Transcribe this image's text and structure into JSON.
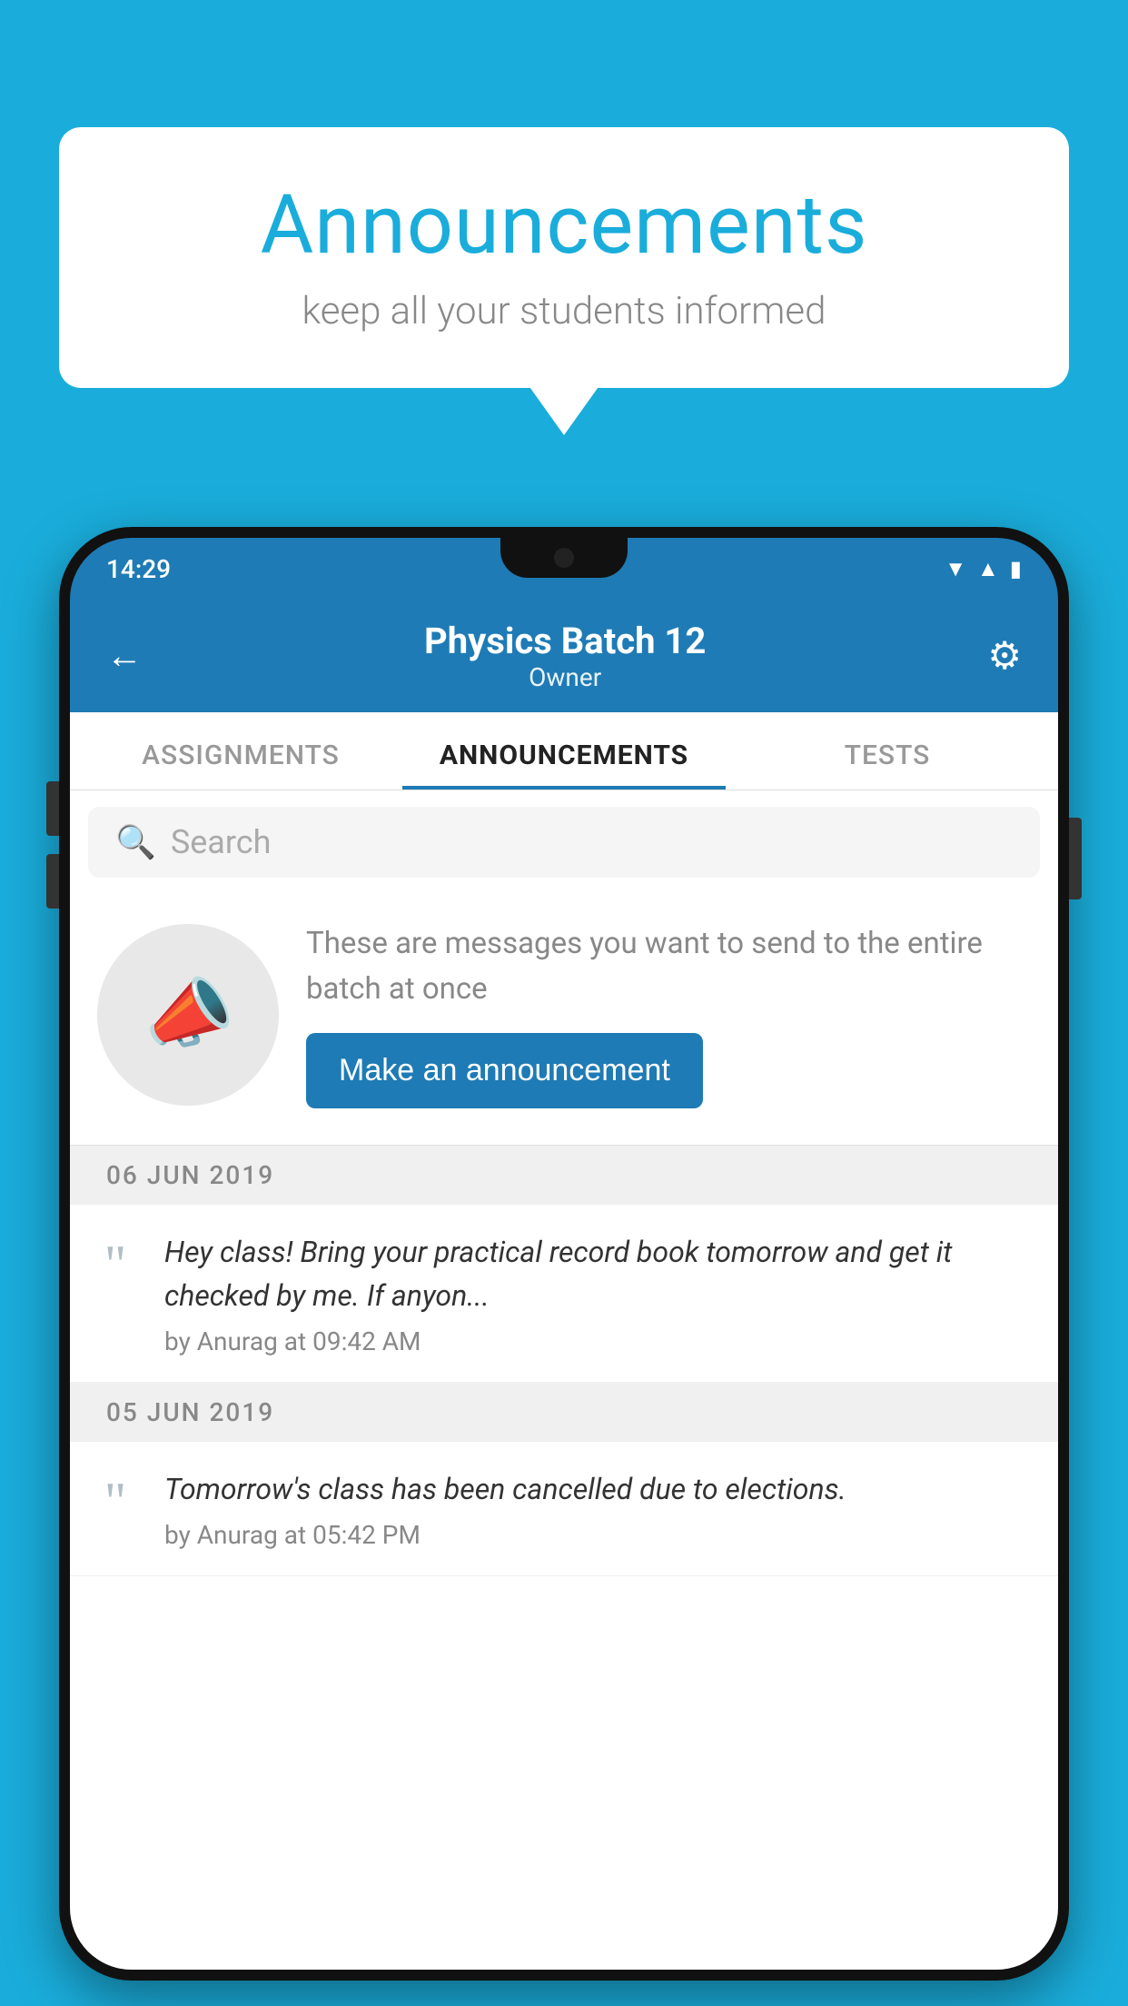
{
  "page": {
    "background_color": "#1AADDB"
  },
  "speech_bubble": {
    "title": "Announcements",
    "subtitle": "keep all your students informed",
    "title_color": "#1AADDB"
  },
  "phone": {
    "status_bar": {
      "time": "14:29"
    },
    "header": {
      "title": "Physics Batch 12",
      "subtitle": "Owner",
      "back_label": "←",
      "gear_label": "⚙"
    },
    "tabs": [
      {
        "label": "ASSIGNMENTS",
        "active": false
      },
      {
        "label": "ANNOUNCEMENTS",
        "active": true
      },
      {
        "label": "TESTS",
        "active": false
      }
    ],
    "search": {
      "placeholder": "Search",
      "search_icon": "🔍"
    },
    "announcement_prompt": {
      "description": "These are messages you want to send to the entire batch at once",
      "button_label": "Make an announcement"
    },
    "announcement_dates": [
      {
        "date": "06  JUN  2019",
        "items": [
          {
            "message": "Hey class! Bring your practical record book tomorrow and get it checked by me. If anyon...",
            "byline": "by Anurag at 09:42 AM"
          }
        ]
      },
      {
        "date": "05  JUN  2019",
        "items": [
          {
            "message": "Tomorrow's class has been cancelled due to elections.",
            "byline": "by Anurag at 05:42 PM"
          }
        ]
      }
    ]
  }
}
